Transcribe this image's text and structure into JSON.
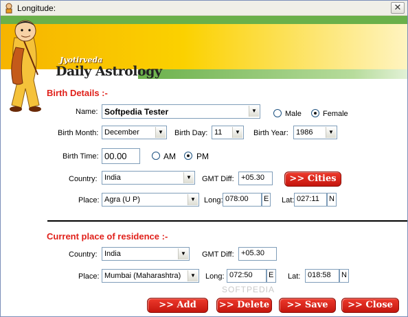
{
  "window": {
    "title": "Longitude:",
    "close_glyph": "✕"
  },
  "brand": {
    "top": "Jyotirveda",
    "main": "Daily Astrology"
  },
  "birth": {
    "section_title": "Birth Details :-",
    "name_label": "Name:",
    "name_value": "Softpedia Tester",
    "gender": {
      "male_label": "Male",
      "female_label": "Female",
      "selected": "Female"
    },
    "month_label": "Birth Month:",
    "month_value": "December",
    "day_label": "Birth Day:",
    "day_value": "11",
    "year_label": "Birth Year:",
    "year_value": "1986",
    "time_label": "Birth Time:",
    "time_value": "00.00",
    "ampm": {
      "am_label": "AM",
      "pm_label": "PM",
      "selected": "PM"
    },
    "country_label": "Country:",
    "country_value": "India",
    "gmt_label": "GMT Diff:",
    "gmt_value": "+05.30",
    "cities_button": ">> Cities",
    "place_label": "Place:",
    "place_value": "Agra (U P)",
    "long_label": "Long:",
    "long_value": "078:00",
    "long_dir": "E",
    "lat_label": "Lat:",
    "lat_value": "027:11",
    "lat_dir": "N"
  },
  "residence": {
    "section_title": "Current place of residence :-",
    "country_label": "Country:",
    "country_value": "India",
    "gmt_label": "GMT Diff:",
    "gmt_value": "+05.30",
    "place_label": "Place:",
    "place_value": "Mumbai (Maharashtra)",
    "long_label": "Long:",
    "long_value": "072:50",
    "long_dir": "E",
    "lat_label": "Lat:",
    "lat_value": "018:58",
    "lat_dir": "N"
  },
  "actions": {
    "add": ">> Add",
    "delete": ">> Delete",
    "save": ">> Save",
    "close": ">> Close"
  },
  "watermark": "SOFTPEDIA",
  "colors": {
    "accent_red": "#e0201a",
    "button_red": "#d4241a",
    "banner_green": "#6ab04a",
    "banner_orange": "#f6b400"
  }
}
